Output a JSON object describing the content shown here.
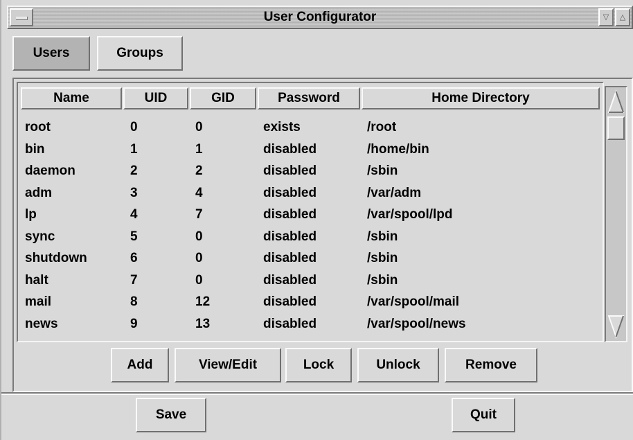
{
  "window": {
    "title": "User Configurator",
    "minimize_glyph": "▽",
    "maximize_glyph": "△"
  },
  "tabs": [
    {
      "label": "Users",
      "active": true
    },
    {
      "label": "Groups",
      "active": false
    }
  ],
  "table": {
    "columns": [
      "Name",
      "UID",
      "GID",
      "Password",
      "Home Directory"
    ],
    "rows": [
      {
        "name": "root",
        "uid": "0",
        "gid": "0",
        "password": "exists",
        "home": "/root"
      },
      {
        "name": "bin",
        "uid": "1",
        "gid": "1",
        "password": "disabled",
        "home": "/home/bin"
      },
      {
        "name": "daemon",
        "uid": "2",
        "gid": "2",
        "password": "disabled",
        "home": "/sbin"
      },
      {
        "name": "adm",
        "uid": "3",
        "gid": "4",
        "password": "disabled",
        "home": "/var/adm"
      },
      {
        "name": "lp",
        "uid": "4",
        "gid": "7",
        "password": "disabled",
        "home": "/var/spool/lpd"
      },
      {
        "name": "sync",
        "uid": "5",
        "gid": "0",
        "password": "disabled",
        "home": "/sbin"
      },
      {
        "name": "shutdown",
        "uid": "6",
        "gid": "0",
        "password": "disabled",
        "home": "/sbin"
      },
      {
        "name": "halt",
        "uid": "7",
        "gid": "0",
        "password": "disabled",
        "home": "/sbin"
      },
      {
        "name": "mail",
        "uid": "8",
        "gid": "12",
        "password": "disabled",
        "home": "/var/spool/mail"
      },
      {
        "name": "news",
        "uid": "9",
        "gid": "13",
        "password": "disabled",
        "home": "/var/spool/news"
      }
    ]
  },
  "actions": {
    "add": "Add",
    "view_edit": "View/Edit",
    "lock": "Lock",
    "unlock": "Unlock",
    "remove": "Remove"
  },
  "footer": {
    "save": "Save",
    "quit": "Quit"
  },
  "icons": {
    "scroll_up": "scroll-up-arrow-icon",
    "scroll_down": "scroll-down-arrow-icon"
  }
}
